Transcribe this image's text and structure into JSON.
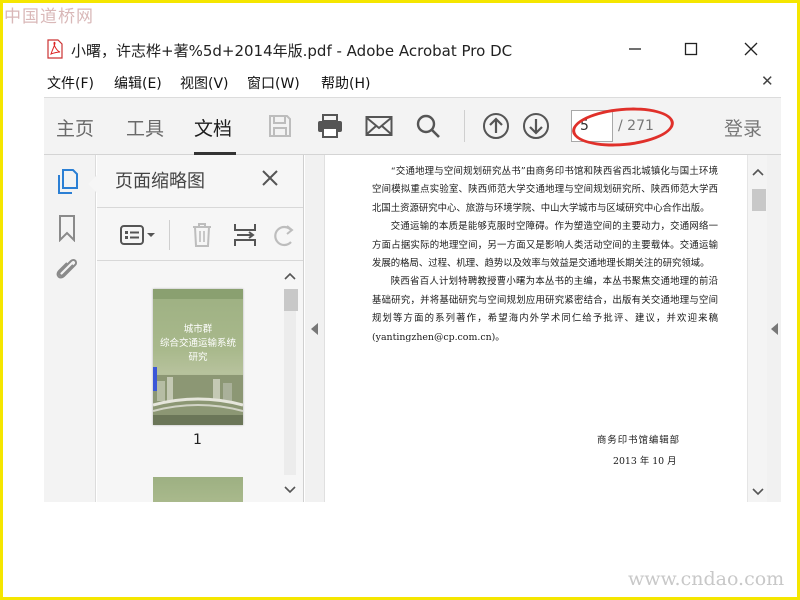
{
  "watermarks": {
    "top": "中国道桥网",
    "bottom": "www.cndao.com"
  },
  "window": {
    "title": "小曙，许志桦+著%5d+2014年版.pdf - Adobe Acrobat Pro DC"
  },
  "menu": {
    "items": [
      "文件(F)",
      "编辑(E)",
      "视图(V)",
      "窗口(W)",
      "帮助(H)"
    ]
  },
  "toolbar": {
    "tabs": [
      "主页",
      "工具",
      "文档"
    ],
    "active_tab": "文档",
    "icons": [
      "save-icon",
      "print-icon",
      "email-icon",
      "search-icon",
      "page-up-icon",
      "page-down-icon"
    ],
    "page_current": "5",
    "page_total": "/ 271",
    "login": "登录"
  },
  "left_rail": {
    "icons": [
      "page-thumbnails-icon",
      "bookmark-icon",
      "attachment-icon"
    ]
  },
  "thumbnails_panel": {
    "title": "页面缩略图",
    "thumbnails": [
      {
        "label": "1",
        "cover_text": [
          "城市群",
          "综合交通运输系统",
          "研究"
        ]
      }
    ]
  },
  "document": {
    "paragraphs": [
      "“交通地理与空间规划研究丛书”由商务印书馆和陕西省西北城镇化与国土环境空间模拟重点实验室、陕西师范大学交通地理与空间规划研究所、陕西师范大学西北国土资源研究中心、旅游与环境学院、中山大学城市与区域研究中心合作出版。",
      "交通运输的本质是能够克服时空障碍。作为塑造空间的主要动力，交通网络一方面占据实际的地理空间，另一方面又是影响人类活动空间的主要载体。交通运输发展的格局、过程、机理、趋势以及效率与效益是交通地理长期关注的研究领域。",
      "陕西省百人计划特聘教授曹小曙为本丛书的主编，本丛书聚焦交通地理的前沿基础研究，并将基础研究与空间规划应用研究紧密结合，出版有关交通地理与空间规划等方面的系列著作，希望海内外学术同仁给予批评、建议，并欢迎来稿(yantingzhen@cp.com.cn)。"
    ],
    "signature": "商务印书馆编辑部",
    "date": "2013 年 10 月"
  },
  "colors": {
    "annotation_oval": "#e0302a",
    "frame_border": "#f5e600"
  }
}
